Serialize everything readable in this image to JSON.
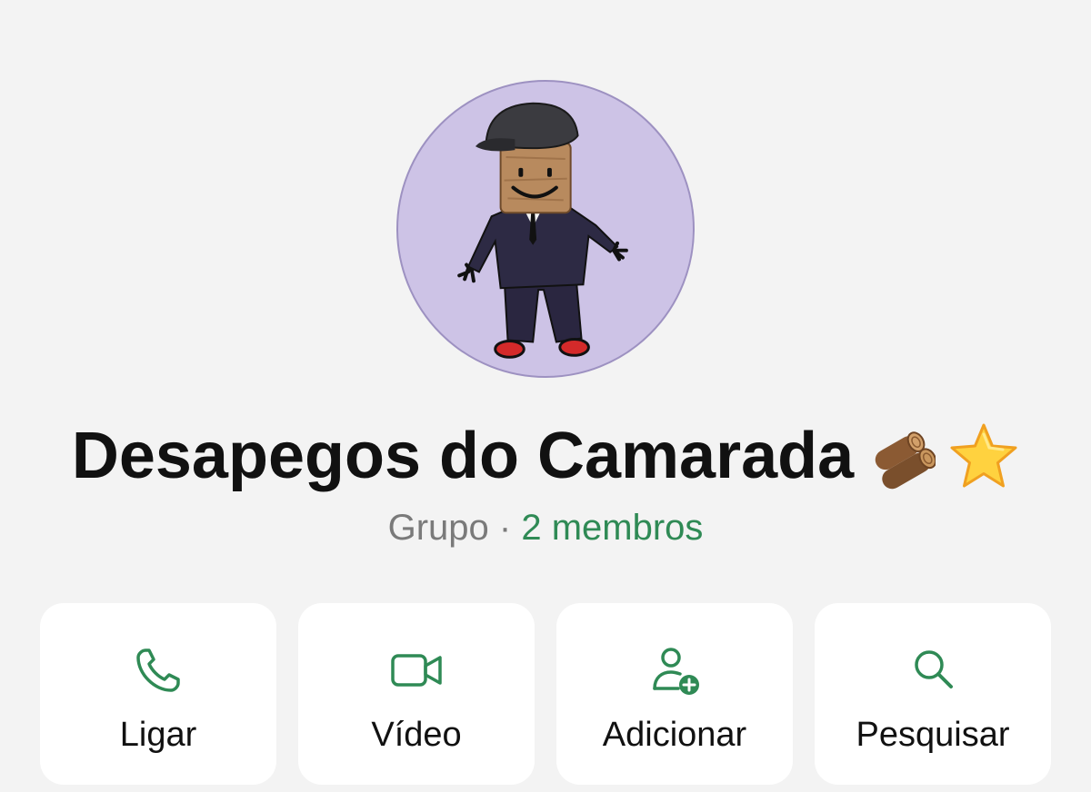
{
  "group": {
    "name": "Desapegos do Camarada",
    "emojis": [
      "wood-logs-emoji",
      "star-emoji"
    ],
    "type_label": "Grupo",
    "separator": " · ",
    "members_label": "2 membros"
  },
  "colors": {
    "background": "#f3f3f3",
    "accent": "#2f8a55",
    "avatar_bg": "#cdc3e6",
    "card_bg": "#ffffff",
    "secondary_text": "#7a7a7a"
  },
  "actions": [
    {
      "label": "Ligar",
      "icon": "phone-icon"
    },
    {
      "label": "Vídeo",
      "icon": "video-camera-icon"
    },
    {
      "label": "Adicionar",
      "icon": "add-person-icon"
    },
    {
      "label": "Pesquisar",
      "icon": "search-icon"
    }
  ]
}
